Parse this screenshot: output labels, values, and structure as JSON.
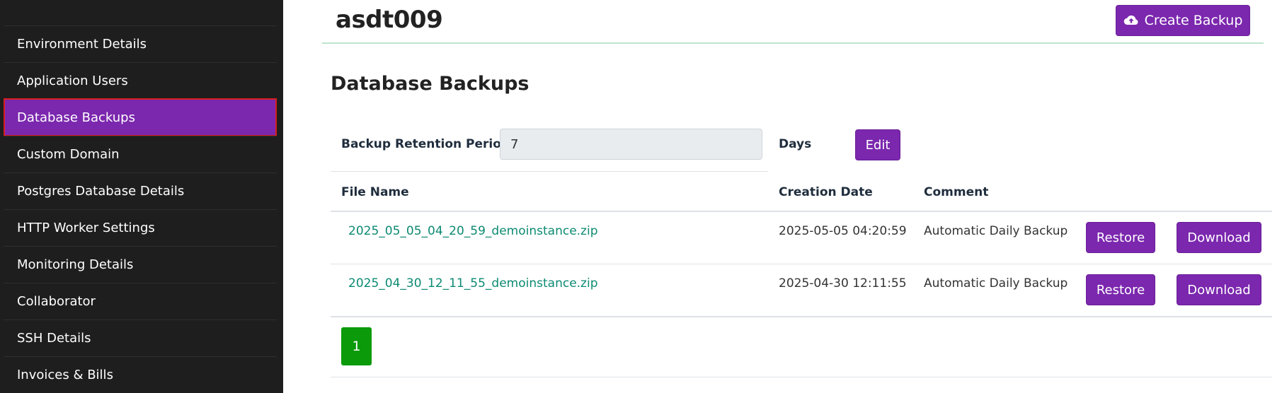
{
  "sidebar": {
    "items": [
      {
        "label": "Environment Details",
        "active": false
      },
      {
        "label": "Application Users",
        "active": false
      },
      {
        "label": "Database Backups",
        "active": true
      },
      {
        "label": "Custom Domain",
        "active": false
      },
      {
        "label": "Postgres Database Details",
        "active": false
      },
      {
        "label": "HTTP Worker Settings",
        "active": false
      },
      {
        "label": "Monitoring Details",
        "active": false
      },
      {
        "label": "Collaborator",
        "active": false
      },
      {
        "label": "SSH Details",
        "active": false
      },
      {
        "label": "Invoices & Bills",
        "active": false
      }
    ],
    "active_color": "#7b27ae",
    "highlight_border_color": "#d61f1f"
  },
  "header": {
    "title": "asdt009",
    "create_backup_label": "Create Backup",
    "create_backup_icon": "cloud-upload-icon"
  },
  "backups": {
    "section_title": "Database Backups",
    "retention_label": "Backup Retention Period:",
    "retention_value": "7",
    "days_label": "Days",
    "edit_label": "Edit",
    "columns": {
      "file_name": "File Name",
      "creation_date": "Creation Date",
      "comment": "Comment"
    },
    "rows": [
      {
        "file_name": "2025_05_05_04_20_59_demoinstance.zip",
        "creation_date": "2025-05-05 04:20:59",
        "comment": "Automatic Daily Backup",
        "restore_label": "Restore",
        "download_label": "Download"
      },
      {
        "file_name": "2025_04_30_12_11_55_demoinstance.zip",
        "creation_date": "2025-04-30 12:11:55",
        "comment": "Automatic Daily Backup",
        "restore_label": "Restore",
        "download_label": "Download"
      }
    ],
    "pagination": {
      "current_page": "1"
    }
  },
  "colors": {
    "primary": "#7b27ae",
    "link": "#0c8a72",
    "pagination_active": "#0a9a0a",
    "sidebar_bg": "#1e1e1e"
  }
}
